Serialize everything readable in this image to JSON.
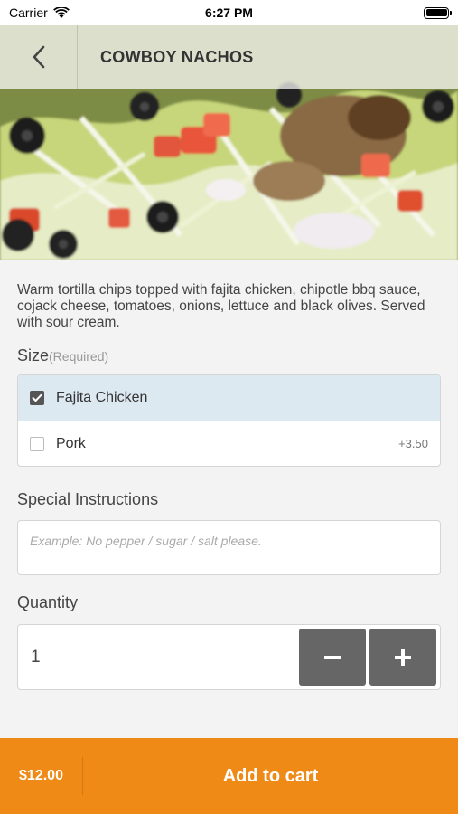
{
  "status_bar": {
    "carrier": "Carrier",
    "time": "6:27 PM",
    "icons": [
      "wifi-icon",
      "battery-icon"
    ]
  },
  "header": {
    "back_icon": "chevron-left-icon",
    "title": "COWBOY NACHOS"
  },
  "item": {
    "image": "nachos-photo",
    "description": "Warm tortilla chips topped with fajita chicken, chipotle bbq sauce, cojack cheese, tomatoes, onions, lettuce and black olives. Served with sour cream."
  },
  "size": {
    "label": "Size",
    "required": "(Required)",
    "options": [
      {
        "label": "Fajita Chicken",
        "price": "",
        "selected": true
      },
      {
        "label": "Pork",
        "price": "+3.50",
        "selected": false
      }
    ]
  },
  "instructions": {
    "label": "Special Instructions",
    "placeholder": "Example: No pepper / sugar / salt please.",
    "value": ""
  },
  "quantity": {
    "label": "Quantity",
    "value": "1",
    "minus_icon": "minus-icon",
    "plus_icon": "plus-icon"
  },
  "cart": {
    "price": "$12.00",
    "label": "Add to cart"
  },
  "colors": {
    "accent": "#ef8a17",
    "selected_row": "#dde9f1",
    "stepper": "#666666"
  }
}
